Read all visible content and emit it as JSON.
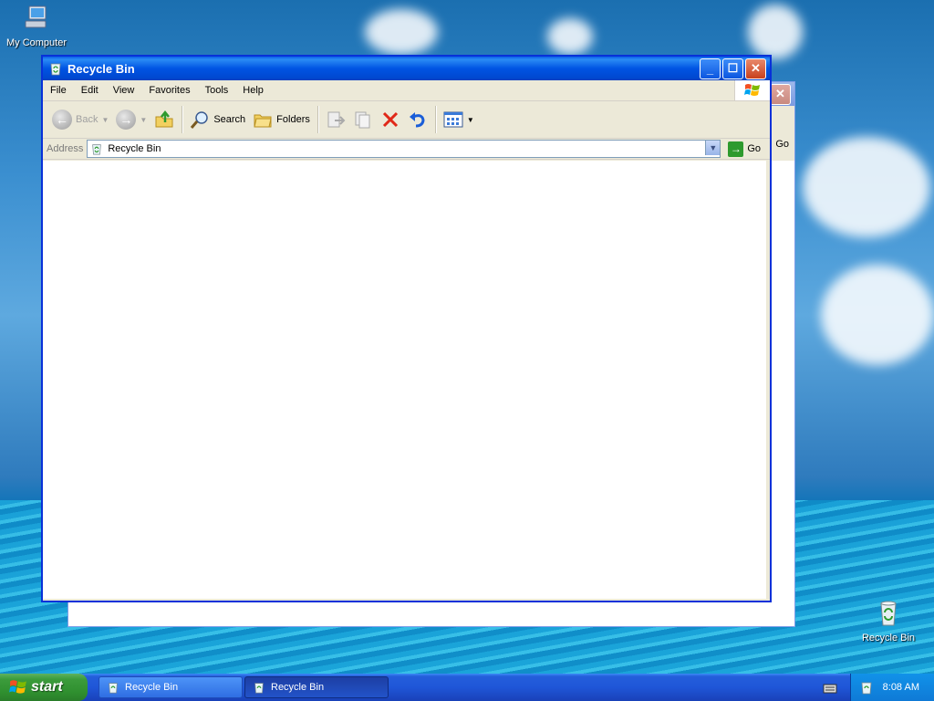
{
  "desktop": {
    "icons": [
      {
        "label": "My Computer",
        "icon": "my-computer-icon"
      },
      {
        "label": "Recycle Bin",
        "icon": "recycle-bin-icon"
      }
    ]
  },
  "back_window": {
    "go_partial": "Go"
  },
  "window": {
    "title": "Recycle Bin",
    "menu": [
      "File",
      "Edit",
      "View",
      "Favorites",
      "Tools",
      "Help"
    ],
    "toolbar": {
      "back": "Back",
      "search": "Search",
      "folders": "Folders"
    },
    "address": {
      "label": "Address",
      "value": "Recycle Bin",
      "go": "Go"
    }
  },
  "taskbar": {
    "start": "start",
    "buttons": [
      {
        "label": "Recycle Bin",
        "active": false
      },
      {
        "label": "Recycle Bin",
        "active": true
      }
    ],
    "clock": "8:08 AM"
  },
  "colors": {
    "titlebar": "#0054e3",
    "start_green": "#3c9c3c",
    "taskbar_blue": "#245edb"
  }
}
